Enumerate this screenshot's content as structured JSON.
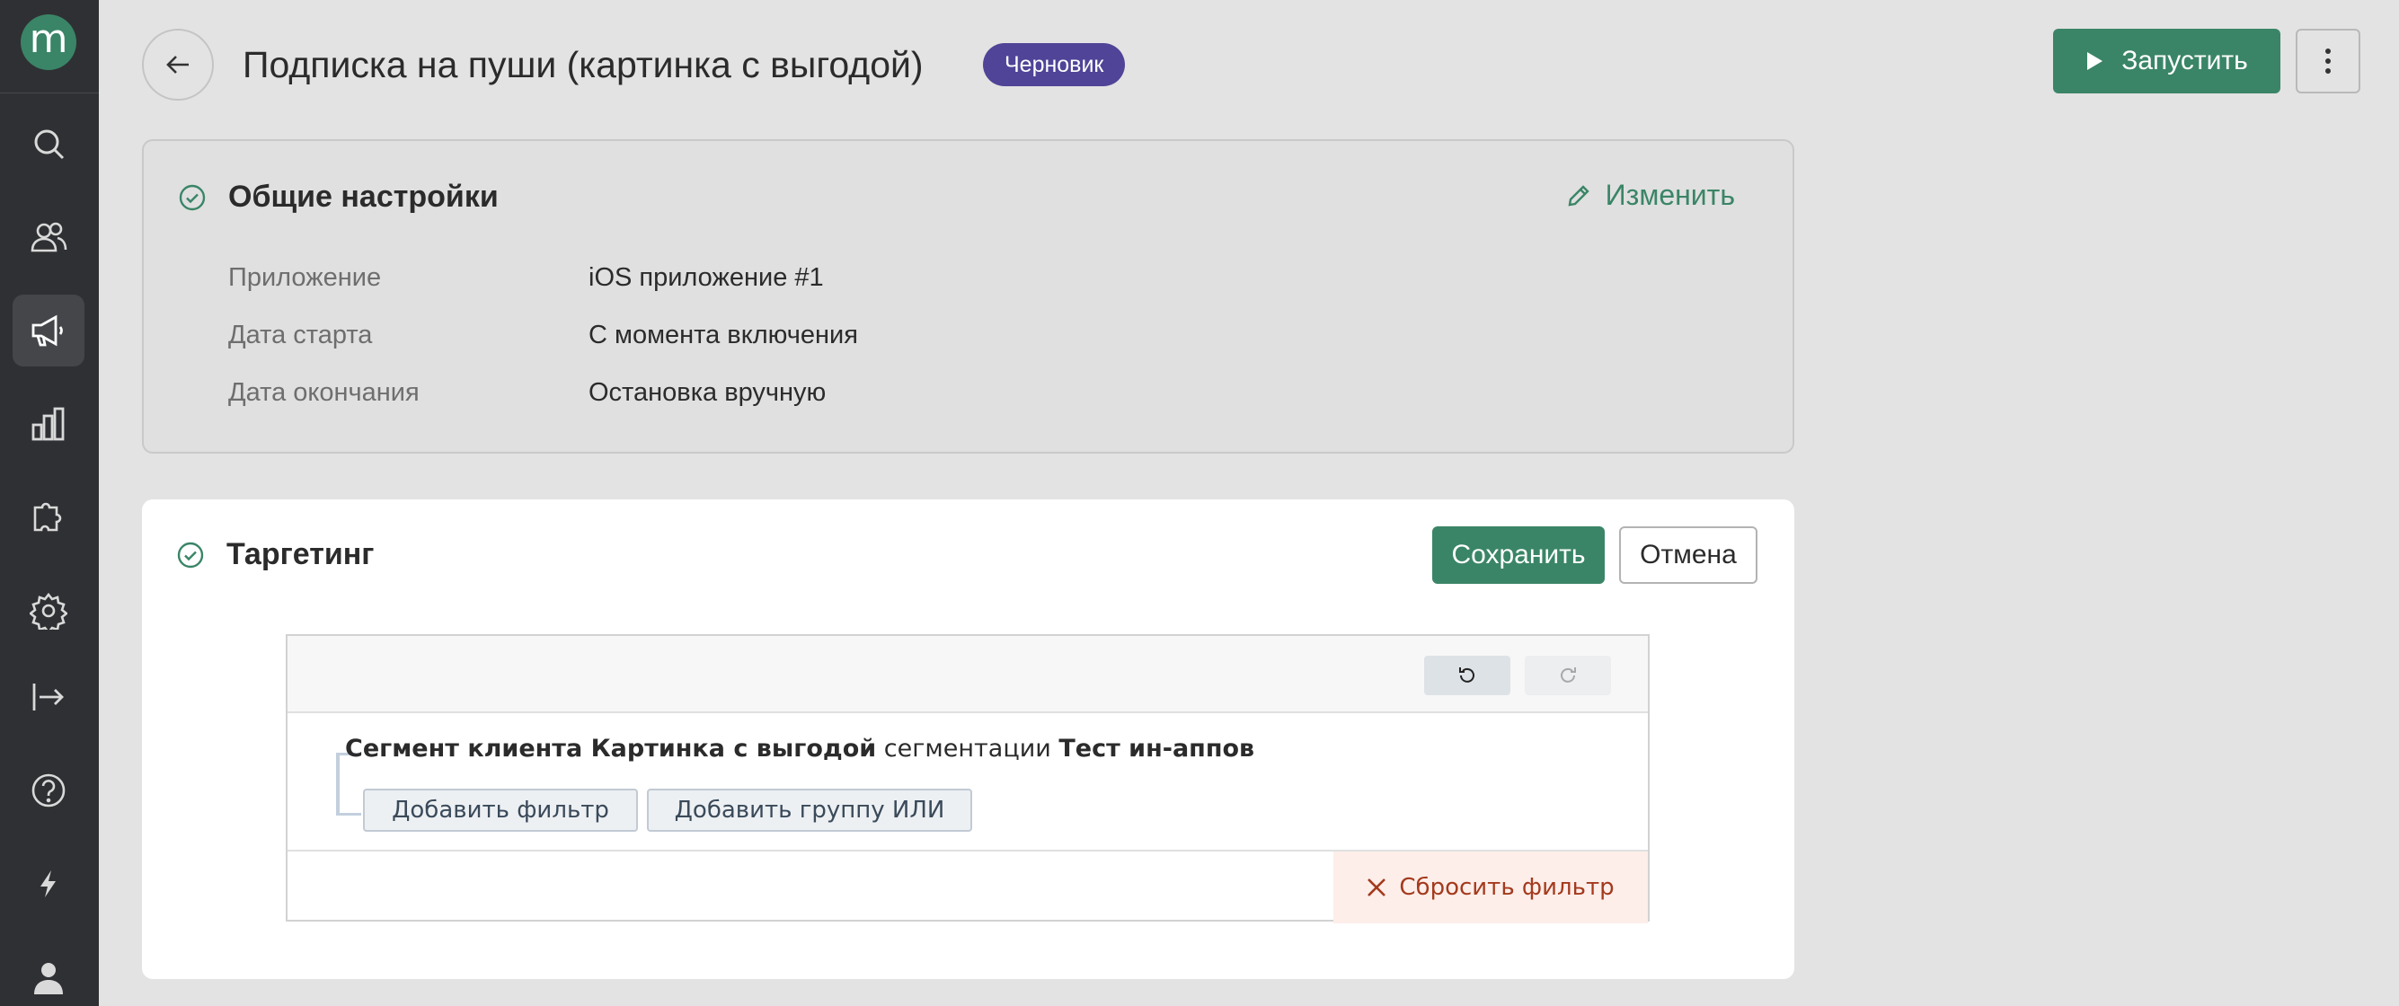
{
  "sidebar": {
    "logo_letter": "m",
    "items": [
      {
        "icon": "search-icon"
      },
      {
        "icon": "users-icon"
      },
      {
        "icon": "megaphone-icon",
        "active": true
      },
      {
        "icon": "bar-chart-icon"
      },
      {
        "icon": "puzzle-icon"
      },
      {
        "icon": "gear-icon"
      },
      {
        "icon": "export-icon"
      },
      {
        "icon": "help-icon"
      },
      {
        "icon": "lightning-icon"
      },
      {
        "icon": "user-icon"
      }
    ]
  },
  "header": {
    "title": "Подписка на пуши (картинка с выгодой)",
    "badge": "Черновик",
    "run_label": "Запустить"
  },
  "general": {
    "title": "Общие настройки",
    "edit_label": "Изменить",
    "rows": [
      {
        "label": "Приложение",
        "value": "iOS приложение #1"
      },
      {
        "label": "Дата старта",
        "value": "С момента включения"
      },
      {
        "label": "Дата окончания",
        "value": "Остановка вручную"
      }
    ]
  },
  "targeting": {
    "title": "Таргетинг",
    "save_label": "Сохранить",
    "cancel_label": "Отмена",
    "segment": {
      "part1": "Сегмент клиента Картинка с выгодой",
      "part2": " сегментации ",
      "part3": "Тест ин-аппов"
    },
    "add_filter_label": "Добавить фильтр",
    "add_or_group_label": "Добавить группу ИЛИ",
    "reset_label": "Сбросить фильтр"
  },
  "colors": {
    "accent": "#3a8567",
    "badge": "#4f4497",
    "sidebar": "#2f3033",
    "reset_text": "#a43a1d"
  }
}
